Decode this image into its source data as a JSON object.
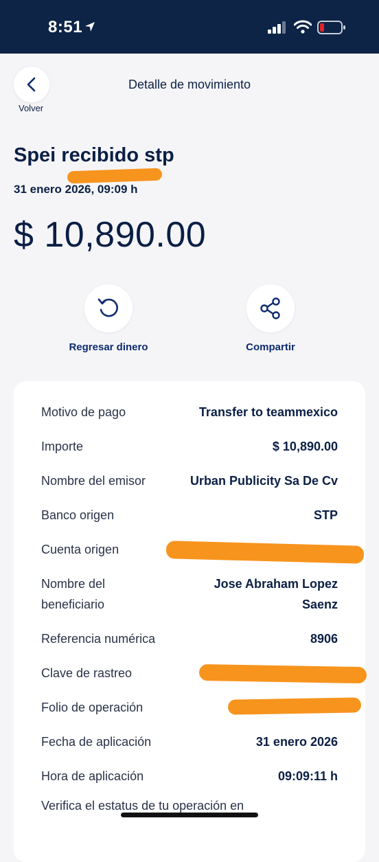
{
  "status_bar": {
    "time": "8:51",
    "icons": [
      "location-arrow-icon",
      "signal-icon",
      "wifi-icon",
      "battery-low-icon"
    ]
  },
  "header": {
    "back_label": "Volver",
    "title": "Detalle de movimiento"
  },
  "movement": {
    "title": "Spei recibido stp",
    "date": "31 enero 2026, 09:09 h",
    "amount": "$ 10,890.00"
  },
  "actions": [
    {
      "label": "Regresar dinero",
      "icon": "return-money-icon"
    },
    {
      "label": "Compartir",
      "icon": "share-icon"
    }
  ],
  "details": [
    {
      "label": "Motivo de pago",
      "value": "Transfer to teammexico"
    },
    {
      "label": "Importe",
      "value": "$ 10,890.00"
    },
    {
      "label": "Nombre del emisor",
      "value": "Urban Publicity Sa De Cv"
    },
    {
      "label": "Banco origen",
      "value": "STP"
    },
    {
      "label": "Cuenta origen",
      "value": ""
    },
    {
      "label": "Nombre del\nbeneficiario",
      "value": "Jose Abraham Lopez\nSaenz"
    },
    {
      "label": "Referencia numérica",
      "value": "8906"
    },
    {
      "label": "Clave de rastreo",
      "value": ""
    },
    {
      "label": "Folio de operación",
      "value": ""
    },
    {
      "label": "Fecha de aplicación",
      "value": "31 enero 2026"
    },
    {
      "label": "Hora de aplicación",
      "value": "09:09:11 h"
    }
  ],
  "footer_note": "Verifica el estatus de tu operación en",
  "colors": {
    "status_bar": "#0d2447",
    "text_primary": "#0b1f45",
    "redaction": "#f7941d",
    "background": "#f5f5f7"
  }
}
